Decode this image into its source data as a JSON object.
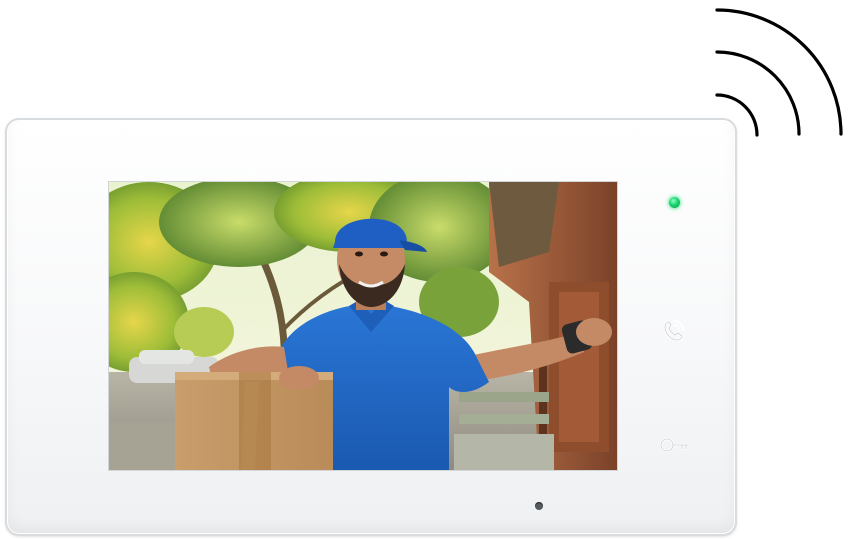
{
  "device": {
    "wireless_icon": "wifi-signal-icon",
    "status_led_color": "#18d36f",
    "talk_icon": "handset-talk-icon",
    "unlock_icon": "key-unlock-icon",
    "panel_color": "#f7f8f9",
    "screen": {
      "feed_icon": "camera-feed-image"
    }
  }
}
